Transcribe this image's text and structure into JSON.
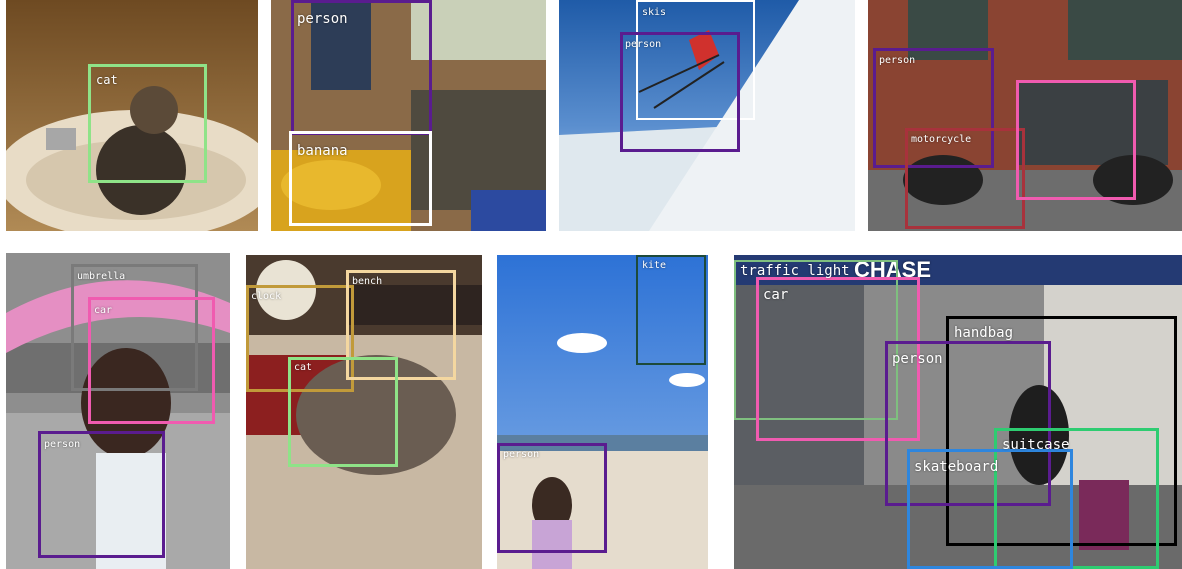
{
  "colors": {
    "cat": "#8fe388",
    "banana": "#ffffff",
    "skis": "#ffffff",
    "person": "#5a1c8f",
    "motorcycle": "#a8323c",
    "car": "#f05bb0",
    "umbrella": "#7a7a7a",
    "clock": "#c19a3a",
    "bench": "#f4d7a0",
    "kite": "#1d4a3a",
    "traffic_light": "#7fbf7f",
    "handbag": "#000000",
    "suitcase": "#2ecc71",
    "skateboard": "#2e86de"
  },
  "panels": [
    {
      "id": "cat-sink",
      "labels": {
        "cat": "cat"
      }
    },
    {
      "id": "market",
      "labels": {
        "person": "person",
        "banana": "banana"
      }
    },
    {
      "id": "skier",
      "labels": {
        "skis": "skis",
        "person": "person"
      }
    },
    {
      "id": "motorcycles",
      "labels": {
        "person": "person",
        "motorcycle": "motorcycle"
      }
    },
    {
      "id": "umbrella-girl",
      "labels": {
        "umbrella": "umbrella",
        "car": "car",
        "person": "person"
      }
    },
    {
      "id": "glasses-cat",
      "labels": {
        "clock": "clock",
        "bench": "bench",
        "cat": "cat"
      }
    },
    {
      "id": "beach-kite",
      "labels": {
        "kite": "kite",
        "person": "person"
      }
    },
    {
      "id": "city-street",
      "labels": {
        "traffic_light": "traffic light",
        "car": "car",
        "handbag": "handbag",
        "person": "person",
        "suitcase": "suitcase",
        "skateboard": "skateboard"
      },
      "sign": "CHASE"
    }
  ]
}
